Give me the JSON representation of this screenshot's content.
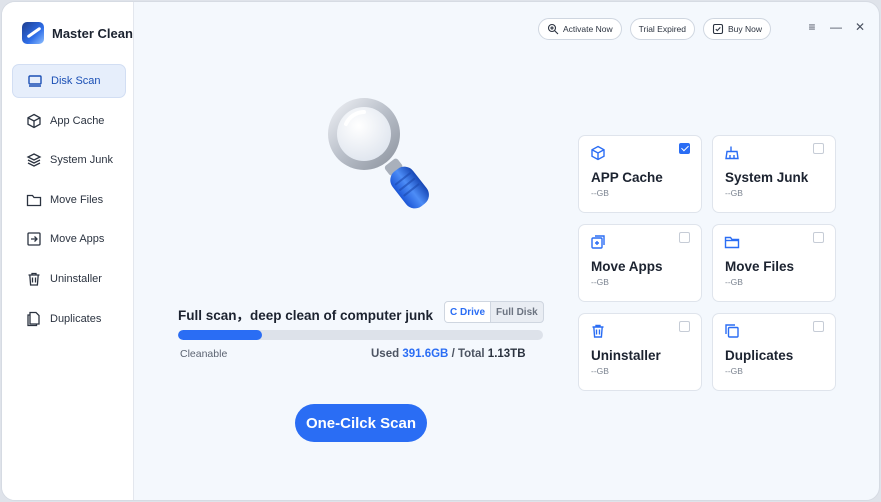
{
  "app": {
    "name": "Master Clean"
  },
  "sidebar": {
    "items": [
      {
        "label": "Disk Scan",
        "icon": "disk-icon",
        "active": true
      },
      {
        "label": "App Cache",
        "icon": "cube-icon",
        "active": false
      },
      {
        "label": "System Junk",
        "icon": "layers-icon",
        "active": false
      },
      {
        "label": "Move Files",
        "icon": "folder-icon",
        "active": false
      },
      {
        "label": "Move Apps",
        "icon": "move-app-icon",
        "active": false
      },
      {
        "label": "Uninstaller",
        "icon": "trash-icon",
        "active": false
      },
      {
        "label": "Duplicates",
        "icon": "duplicate-icon",
        "active": false
      }
    ]
  },
  "topbar": {
    "activate_label": "Activate Now",
    "trial_label": "Trial Expired",
    "buy_label": "Buy Now"
  },
  "window_controls": {
    "menu": "≡",
    "minimize": "—",
    "close": "✕"
  },
  "scan": {
    "title": "Full scan，deep clean of computer junk",
    "drive_options": [
      "C Drive",
      "Full Disk"
    ],
    "selected_drive": "C Drive",
    "progress_fraction": 0.23,
    "cleanable_label": "Cleanable",
    "used_label": "Used",
    "used_value": "391.6GB",
    "separator": "/",
    "total_label": "Total",
    "total_value": "1.13TB",
    "button_label": "One-Cilck Scan"
  },
  "cards": [
    {
      "title": "APP Cache",
      "size": "--GB",
      "checked": true,
      "icon": "cube-icon"
    },
    {
      "title": "System Junk",
      "size": "--GB",
      "checked": false,
      "icon": "broom-icon"
    },
    {
      "title": "Move Apps",
      "size": "--GB",
      "checked": false,
      "icon": "move-app-icon"
    },
    {
      "title": "Move Files",
      "size": "--GB",
      "checked": false,
      "icon": "folder-icon"
    },
    {
      "title": "Uninstaller",
      "size": "--GB",
      "checked": false,
      "icon": "trash-icon"
    },
    {
      "title": "Duplicates",
      "size": "--GB",
      "checked": false,
      "icon": "duplicate-icon"
    }
  ],
  "colors": {
    "accent": "#2a6df4",
    "background": "#f4f8fd",
    "sidebar_active": "#e6eefb"
  }
}
